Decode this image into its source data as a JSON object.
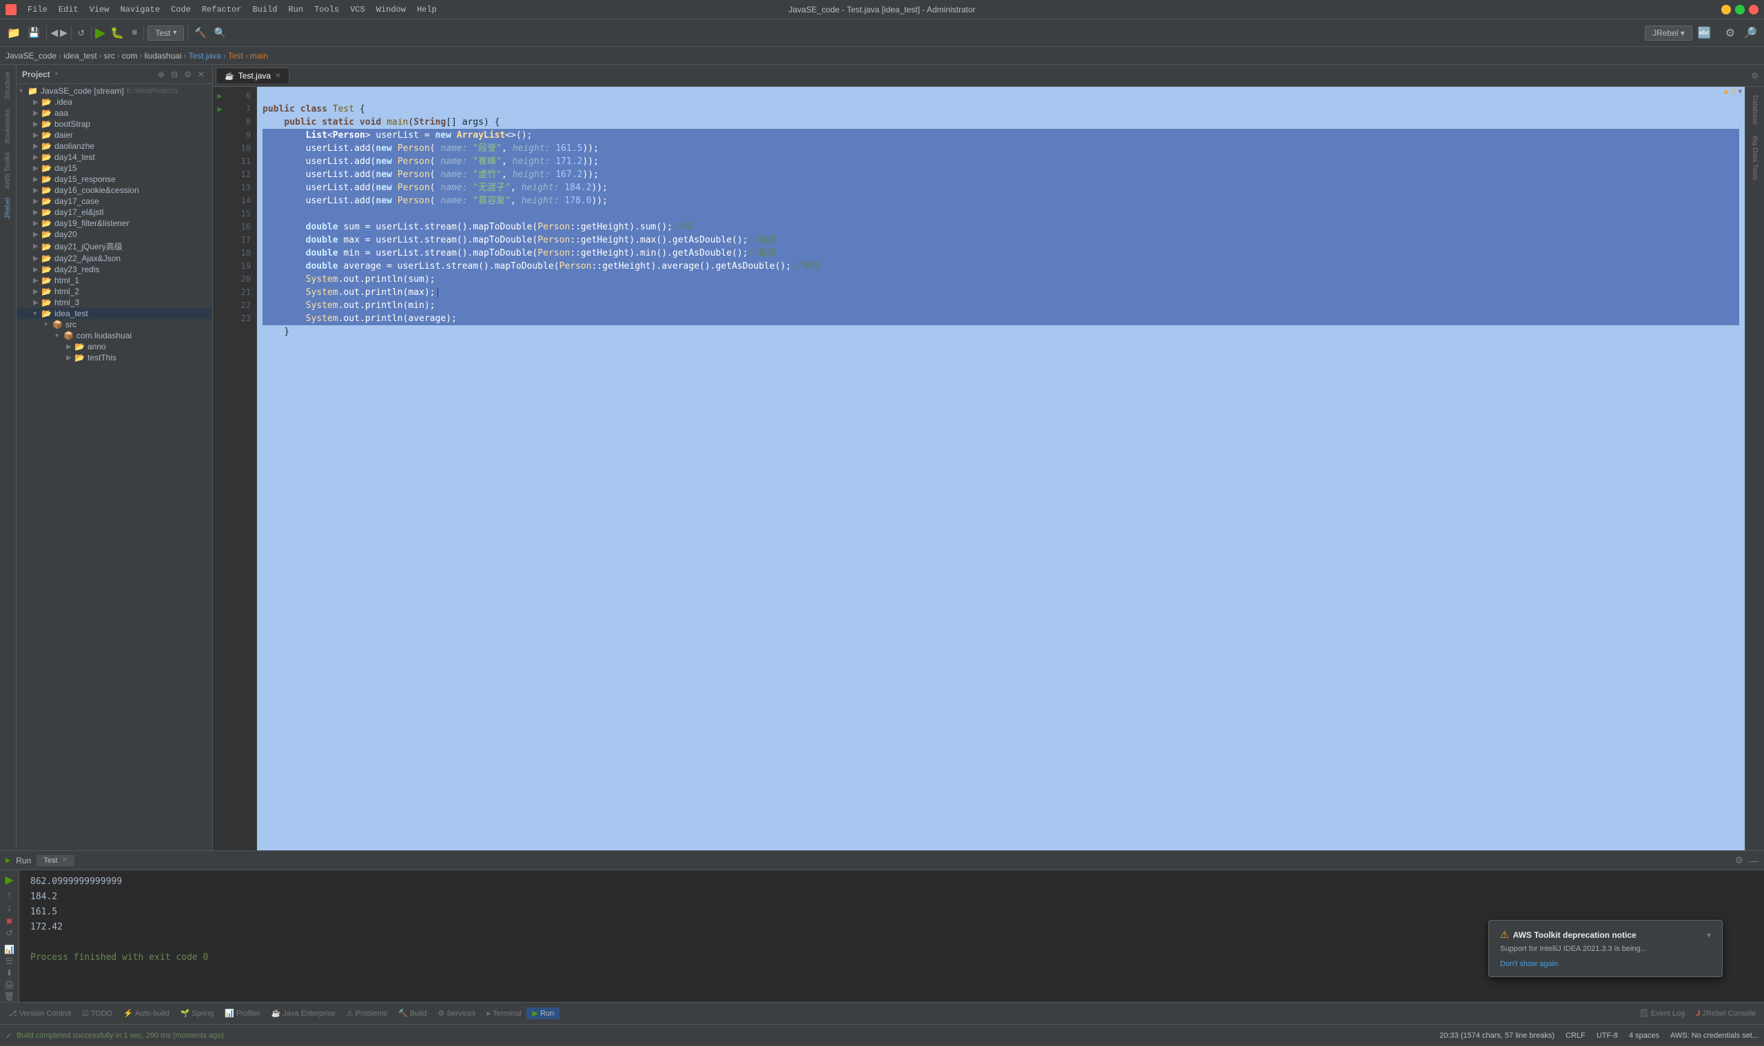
{
  "titleBar": {
    "title": "JavaSE_code - Test.java [idea_test] - Administrator",
    "menus": [
      "File",
      "Edit",
      "View",
      "Navigate",
      "Code",
      "Refactor",
      "Build",
      "Run",
      "Tools",
      "VCS",
      "Window",
      "Help"
    ]
  },
  "toolbar": {
    "runConfig": "Test",
    "jrebel": "JRebel ▾"
  },
  "breadcrumb": {
    "items": [
      "JavaSE_code",
      "idea_test",
      "src",
      "com",
      "liudashuai",
      "Test.java",
      "Test",
      "main"
    ]
  },
  "projectPanel": {
    "title": "Project",
    "rootLabel": "JavaSE_code [stream]",
    "rootPath": "E:\\IdeaProjects",
    "items": [
      {
        "label": ".idea",
        "type": "folder",
        "depth": 1
      },
      {
        "label": "aaa",
        "type": "folder",
        "depth": 1
      },
      {
        "label": "bootStrap",
        "type": "folder",
        "depth": 1
      },
      {
        "label": "daier",
        "type": "folder",
        "depth": 1
      },
      {
        "label": "daolianzhe",
        "type": "folder",
        "depth": 1
      },
      {
        "label": "day14_test",
        "type": "folder",
        "depth": 1
      },
      {
        "label": "day15",
        "type": "folder",
        "depth": 1
      },
      {
        "label": "day15_response",
        "type": "folder",
        "depth": 1
      },
      {
        "label": "day16_cookie&cession",
        "type": "folder",
        "depth": 1
      },
      {
        "label": "day17_case",
        "type": "folder",
        "depth": 1
      },
      {
        "label": "day17_el&jstl",
        "type": "folder",
        "depth": 1
      },
      {
        "label": "day19_filter&listener",
        "type": "folder",
        "depth": 1
      },
      {
        "label": "day20",
        "type": "folder",
        "depth": 1
      },
      {
        "label": "day21_jQuery高级",
        "type": "folder",
        "depth": 1
      },
      {
        "label": "day22_Ajax&Json",
        "type": "folder",
        "depth": 1
      },
      {
        "label": "day23_redis",
        "type": "folder",
        "depth": 1
      },
      {
        "label": "html_1",
        "type": "folder",
        "depth": 1
      },
      {
        "label": "html_2",
        "type": "folder",
        "depth": 1
      },
      {
        "label": "html_3",
        "type": "folder",
        "depth": 1
      },
      {
        "label": "idea_test",
        "type": "folder",
        "depth": 1,
        "open": true
      },
      {
        "label": "src",
        "type": "src",
        "depth": 2,
        "open": true
      },
      {
        "label": "com.liudashuai",
        "type": "pkg",
        "depth": 3,
        "open": true
      },
      {
        "label": "anno",
        "type": "folder",
        "depth": 4
      },
      {
        "label": "testThis",
        "type": "folder",
        "depth": 4
      }
    ]
  },
  "editor": {
    "filename": "Test.java",
    "lines": [
      {
        "num": 6,
        "content": "public class Test {",
        "selected": false
      },
      {
        "num": 7,
        "content": "    public static void main(String[] args) {",
        "selected": false
      },
      {
        "num": 8,
        "content": "        List<Person> userList = new ArrayList<>();",
        "selected": true
      },
      {
        "num": 9,
        "content": "        userList.add(new Person( name: \"段誉\", height: 161.5));",
        "selected": true
      },
      {
        "num": 10,
        "content": "        userList.add(new Person( name: \"崔峰\", height: 171.2));",
        "selected": true
      },
      {
        "num": 11,
        "content": "        userList.add(new Person( name: \"虚竹\", height: 167.2));",
        "selected": true
      },
      {
        "num": 12,
        "content": "        userList.add(new Person( name: \"无涯子\", height: 184.2));",
        "selected": true
      },
      {
        "num": 13,
        "content": "        userList.add(new Person( name: \"慕容复\", height: 178.0));",
        "selected": true
      },
      {
        "num": 14,
        "content": "",
        "selected": true
      },
      {
        "num": 15,
        "content": "        double sum = userList.stream().mapToDouble(Person::getHeight).sum();//和",
        "selected": true
      },
      {
        "num": 16,
        "content": "        double max = userList.stream().mapToDouble(Person::getHeight).max().getAsDouble();//最高",
        "selected": true
      },
      {
        "num": 17,
        "content": "        double min = userList.stream().mapToDouble(Person::getHeight).min().getAsDouble();//最矮",
        "selected": true
      },
      {
        "num": 18,
        "content": "        double average = userList.stream().mapToDouble(Person::getHeight).average().getAsDouble();//平均",
        "selected": true
      },
      {
        "num": 19,
        "content": "        System.out.println(sum);",
        "selected": true
      },
      {
        "num": 20,
        "content": "        System.out.println(max);",
        "selected": true
      },
      {
        "num": 21,
        "content": "        System.out.println(min);",
        "selected": true
      },
      {
        "num": 22,
        "content": "        System.out.println(average);",
        "selected": true
      },
      {
        "num": 23,
        "content": "    }",
        "selected": false
      }
    ]
  },
  "runPanel": {
    "title": "Run",
    "tabLabel": "Test",
    "output": [
      {
        "text": "862.0999999999999",
        "type": "normal"
      },
      {
        "text": "184.2",
        "type": "normal"
      },
      {
        "text": "161.5",
        "type": "normal"
      },
      {
        "text": "172.42",
        "type": "normal"
      },
      {
        "text": "",
        "type": "blank"
      },
      {
        "text": "Process finished with exit code 0",
        "type": "process"
      }
    ]
  },
  "statusBar": {
    "buildStatus": "Build completed successfully in 1 sec, 290 ms (moments ago)",
    "position": "20:33 (1574 chars, 57 line breaks)",
    "encoding": "CRLF",
    "charset": "UTF-8",
    "indent": "4 spaces",
    "aws": "AWS: No credentials set..."
  },
  "bottomToolbar": {
    "items": [
      {
        "label": "Version Control",
        "icon": "⚙"
      },
      {
        "label": "TODO",
        "icon": "☰"
      },
      {
        "label": "Auto-build",
        "icon": "⚡"
      },
      {
        "label": "Spring",
        "icon": "🍃"
      },
      {
        "label": "Profiler",
        "icon": "📊"
      },
      {
        "label": "Java Enterprise",
        "icon": "☕"
      },
      {
        "label": "Problems",
        "icon": "⚠"
      },
      {
        "label": "Build",
        "icon": "🔨"
      },
      {
        "label": "Services",
        "icon": "⚙"
      },
      {
        "label": "Terminal",
        "icon": ">"
      },
      {
        "label": "Run",
        "icon": "▶",
        "active": true
      },
      {
        "label": "Event Log",
        "icon": "📋"
      },
      {
        "label": "JRebel Console",
        "icon": "J"
      }
    ]
  },
  "awsNotice": {
    "title": "AWS Toolkit deprecation notice",
    "body": "Support for IntelliJ IDEA 2021.3.3 is being...",
    "action": "Don't show again"
  },
  "warningBadge": {
    "count": "▲ 2"
  },
  "rightPanels": [
    {
      "label": "Database"
    },
    {
      "label": "Big Data Tools"
    }
  ]
}
